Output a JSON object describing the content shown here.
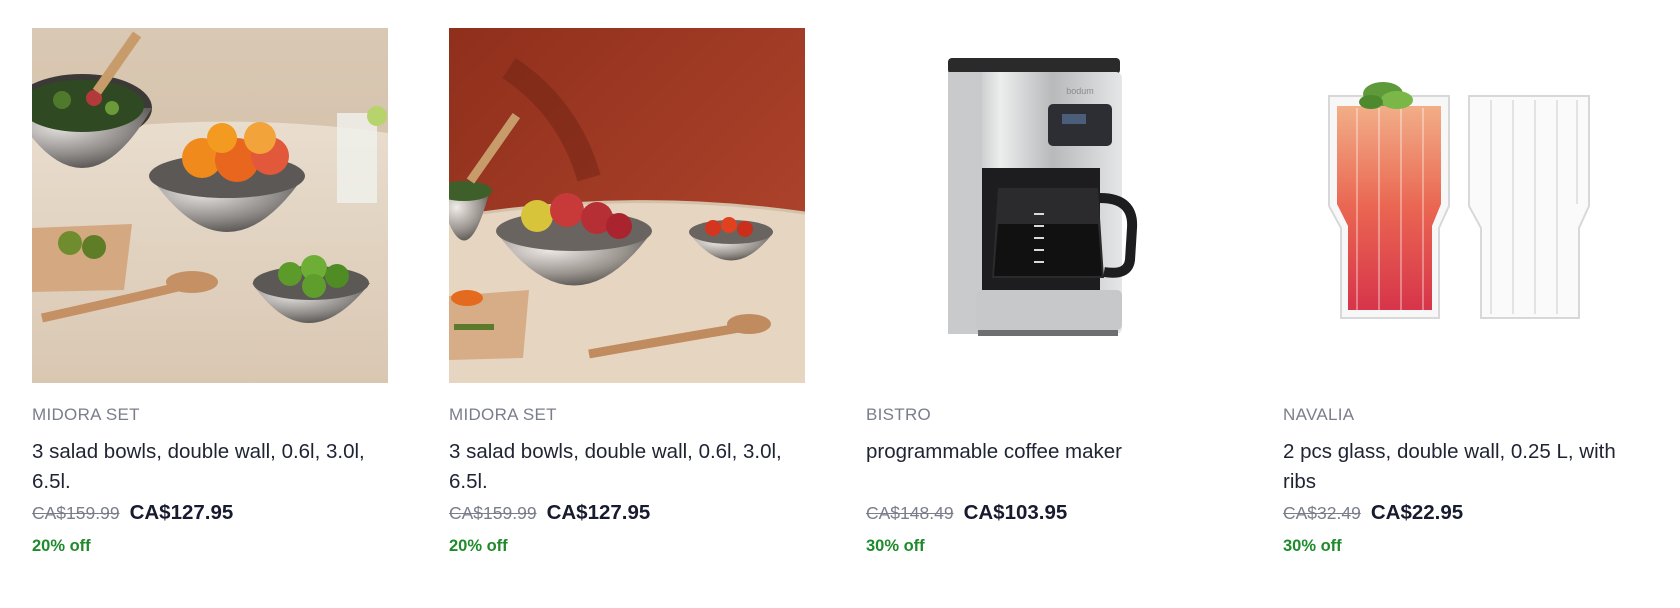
{
  "products": [
    {
      "image_icon": "salad-bowls-photo-icon",
      "collection": "MIDORA SET",
      "title": "3 salad bowls, double wall, 0.6l, 3.0l, 6.5l.",
      "old_price": "CA$159.99",
      "price": "CA$127.95",
      "discount": "20% off"
    },
    {
      "image_icon": "salad-bowls-orange-wall-photo-icon",
      "collection": "MIDORA SET",
      "title": "3 salad bowls, double wall, 0.6l, 3.0l, 6.5l.",
      "old_price": "CA$159.99",
      "price": "CA$127.95",
      "discount": "20% off"
    },
    {
      "image_icon": "coffee-maker-photo-icon",
      "collection": "BISTRO",
      "title": "programmable coffee maker",
      "old_price": "CA$148.49",
      "price": "CA$103.95",
      "discount": "30% off",
      "brand_mark": "bodum"
    },
    {
      "image_icon": "double-wall-glasses-photo-icon",
      "collection": "NAVALIA",
      "title": "2 pcs glass, double wall, 0.25 L, with ribs",
      "old_price": "CA$32.49",
      "price": "CA$22.95",
      "discount": "30% off"
    }
  ],
  "colors": {
    "discount": "#1f8a2b",
    "muted": "#7a7e8a",
    "text": "#1f2433",
    "accent_wall": "#a8402a"
  }
}
